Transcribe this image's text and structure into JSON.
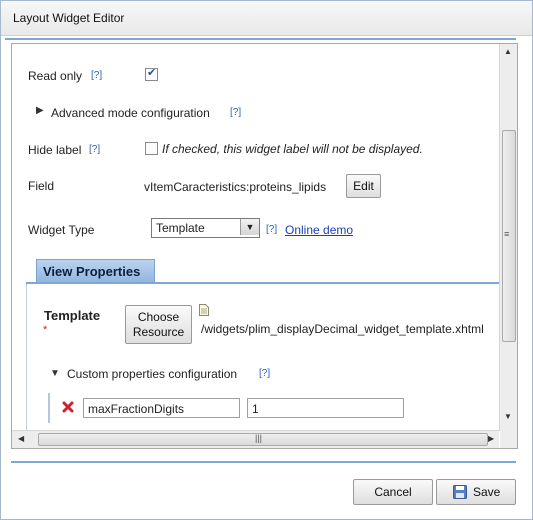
{
  "dialog": {
    "title": "Layout Widget Editor"
  },
  "form": {
    "read_only_label": "Read only",
    "read_only_help": "[?]",
    "read_only_checked": true,
    "advanced_label": "Advanced mode configuration",
    "advanced_help": "[?]",
    "hide_label_label": "Hide label",
    "hide_label_help": "[?]",
    "hide_label_note": "If checked, this widget label will not be displayed.",
    "field_label": "Field",
    "field_value": "vItemCaracteristics:proteins_lipids",
    "field_edit_button": "Edit",
    "widget_type_label": "Widget Type",
    "widget_type_value": "Template",
    "widget_type_help": "[?]",
    "online_demo_link": "Online demo"
  },
  "view_properties": {
    "tab_label": "View Properties",
    "template_label": "Template",
    "required_marker": "*",
    "choose_resource_line1": "Choose",
    "choose_resource_line2": "Resource",
    "template_path": "/widgets/plim_displayDecimal_widget_template.xhtml",
    "custom_props_label": "Custom properties configuration",
    "custom_props_help": "[?]",
    "property_rows": [
      {
        "name": "maxFractionDigits",
        "value": "1"
      }
    ]
  },
  "footer": {
    "cancel_label": "Cancel",
    "save_label": "Save"
  },
  "colors": {
    "accent_line": "#7fa7d6",
    "tab_bg": "#a8c7ea",
    "link": "#1a3fb3",
    "delete_icon": "#d0202a"
  }
}
